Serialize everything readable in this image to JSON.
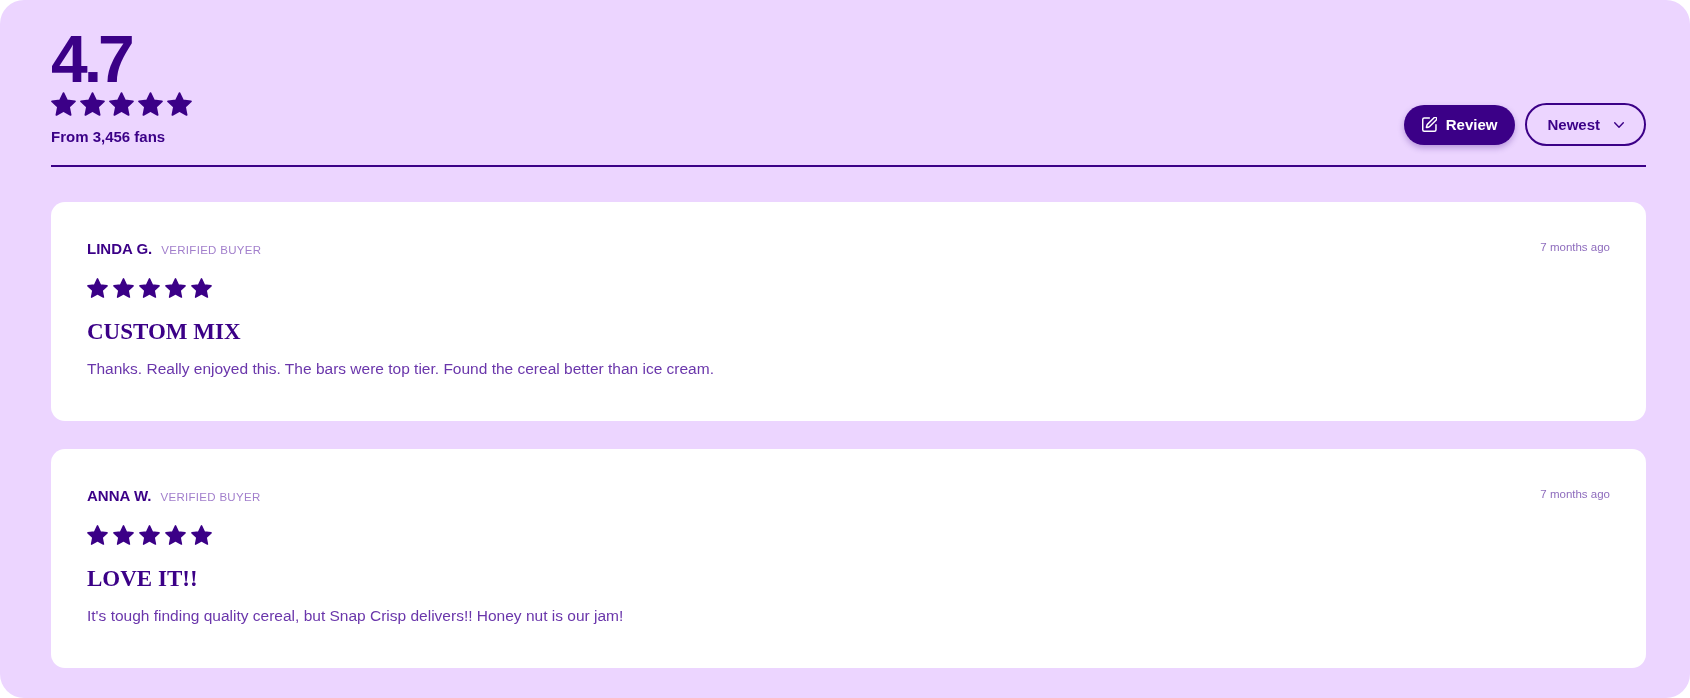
{
  "summary": {
    "rating": "4.7",
    "stars": 5,
    "fans": "From 3,456 fans"
  },
  "actions": {
    "review_button": "Review",
    "sort": {
      "value": "Newest"
    }
  },
  "reviews": [
    {
      "name": "LINDA G.",
      "badge": "VERIFIED BUYER",
      "time": "7 months ago",
      "stars": 5,
      "title": "CUSTOM MIX",
      "body": "Thanks. Really enjoyed this. The bars were top tier. Found the cereal better than ice cream."
    },
    {
      "name": "ANNA W.",
      "badge": "VERIFIED BUYER",
      "time": "7 months ago",
      "stars": 5,
      "title": "LOVE IT!!",
      "body": "It's tough finding quality cereal, but Snap Crisp delivers!! Honey nut is our jam!"
    }
  ]
}
